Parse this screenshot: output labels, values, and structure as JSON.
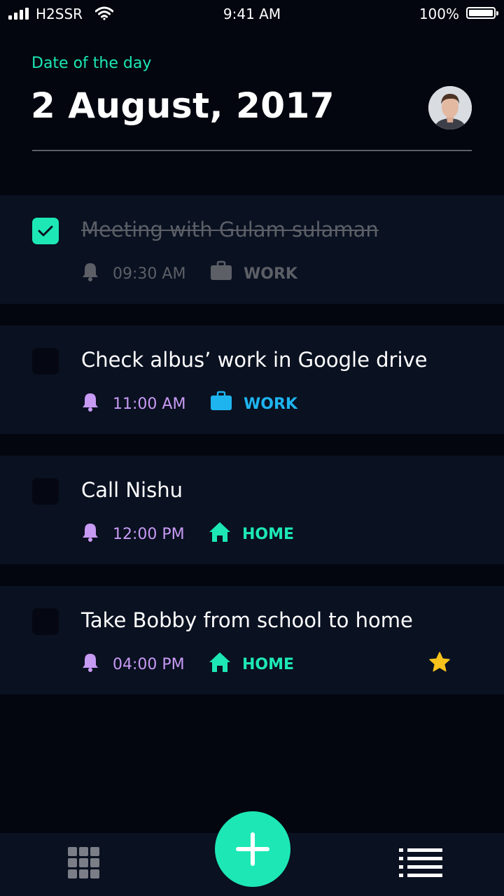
{
  "status_bar": {
    "carrier": "H2SSR",
    "time": "9:41 AM",
    "battery": "100%"
  },
  "header": {
    "label": "Date of the day",
    "date": "2 August, 2017"
  },
  "tasks": [
    {
      "title": "Meeting with Gulam sulaman",
      "time": "09:30 AM",
      "tag": "WORK",
      "done": true,
      "starred": false
    },
    {
      "title": "Check albus’ work in Google drive",
      "time": "11:00 AM",
      "tag": "WORK",
      "done": false,
      "starred": false
    },
    {
      "title": "Call Nishu",
      "time": "12:00 PM",
      "tag": "HOME",
      "done": false,
      "starred": false
    },
    {
      "title": "Take Bobby from school to home",
      "time": "04:00 PM",
      "tag": "HOME",
      "done": false,
      "starred": true
    }
  ],
  "colors": {
    "accent": "#1de8b5",
    "time": "#c79af4",
    "work": "#1eb4ef",
    "home": "#1de8b5",
    "done": "#5c5f66",
    "star": "#f7c21b"
  },
  "icons": {
    "grid": "grid-icon",
    "add": "plus-icon",
    "list": "list-icon"
  }
}
